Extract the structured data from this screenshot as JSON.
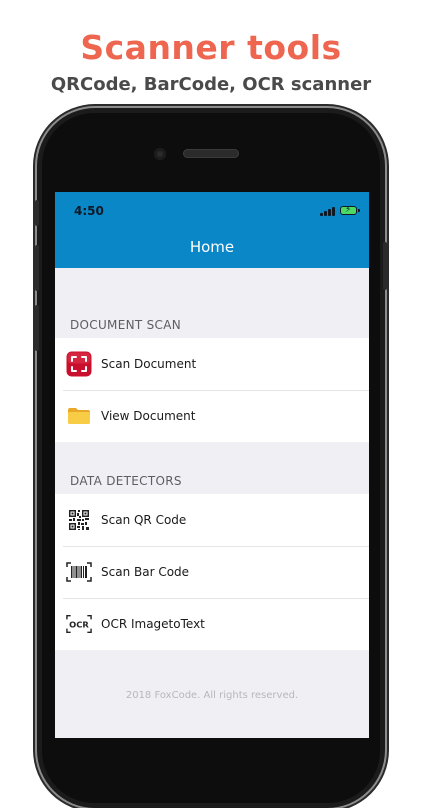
{
  "promo": {
    "title": "Scanner tools",
    "subtitle": "QRCode, BarCode, OCR scanner"
  },
  "status_bar": {
    "time": "4:50"
  },
  "nav": {
    "title": "Home"
  },
  "sections": [
    {
      "header": "DOCUMENT SCAN",
      "items": [
        {
          "label": "Scan Document",
          "icon": "scan-document-icon"
        },
        {
          "label": "View Document",
          "icon": "folder-icon"
        }
      ]
    },
    {
      "header": "DATA DETECTORS",
      "items": [
        {
          "label": "Scan QR Code",
          "icon": "qr-code-icon"
        },
        {
          "label": "Scan Bar Code",
          "icon": "barcode-icon"
        },
        {
          "label": "OCR ImagetoText",
          "icon": "ocr-icon"
        }
      ]
    }
  ],
  "footer": {
    "text": "2018 FoxCode. All rights reserved."
  },
  "colors": {
    "promo_title": "#ee6650",
    "nav_bar": "#0a87c6",
    "scan_icon": "#c8102e",
    "folder_icon": "#f5c33b"
  }
}
